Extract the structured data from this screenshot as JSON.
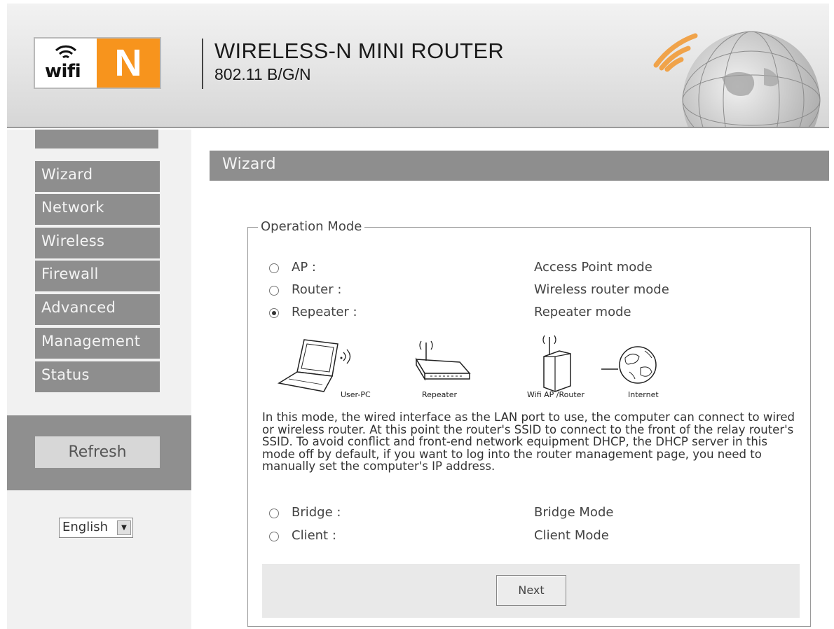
{
  "header": {
    "logo_wifi_text": "wifi",
    "logo_n_text": "N",
    "title": "WIRELESS-N MINI ROUTER",
    "subtitle": "802.11 B/G/N"
  },
  "sidebar": {
    "items": [
      {
        "label": "Wizard"
      },
      {
        "label": "Network"
      },
      {
        "label": "Wireless"
      },
      {
        "label": "Firewall"
      },
      {
        "label": "Advanced"
      },
      {
        "label": "Management"
      },
      {
        "label": "Status"
      }
    ],
    "refresh_label": "Refresh",
    "language": {
      "selected": "English"
    }
  },
  "main": {
    "page_title": "Wizard",
    "fieldset_legend": "Operation Mode",
    "options": [
      {
        "label": "AP :",
        "description": "Access Point mode",
        "checked": false
      },
      {
        "label": "Router :",
        "description": "Wireless router mode",
        "checked": false
      },
      {
        "label": "Repeater :",
        "description": "Repeater mode",
        "checked": true
      },
      {
        "label": "Bridge :",
        "description": "Bridge Mode",
        "checked": false
      },
      {
        "label": "Client :",
        "description": "Client Mode",
        "checked": false
      }
    ],
    "diagram": {
      "labels": [
        "User-PC",
        "Repeater",
        "Wifi AP /Router",
        "Internet"
      ]
    },
    "description": "In this mode, the wired interface as the LAN port to use, the computer can connect to wired or wireless router. At this point the router's SSID to connect to the front of the relay router's SSID. To avoid conflict and front-end network equipment DHCP, the DHCP server in this mode off by default, if you want to log into the router management page, you need to manually set the computer's IP address.",
    "next_label": "Next"
  },
  "colors": {
    "accent_orange": "#f7941d",
    "menu_gray": "#8e8e8e",
    "sidebar_bg": "#f1f1f1"
  }
}
